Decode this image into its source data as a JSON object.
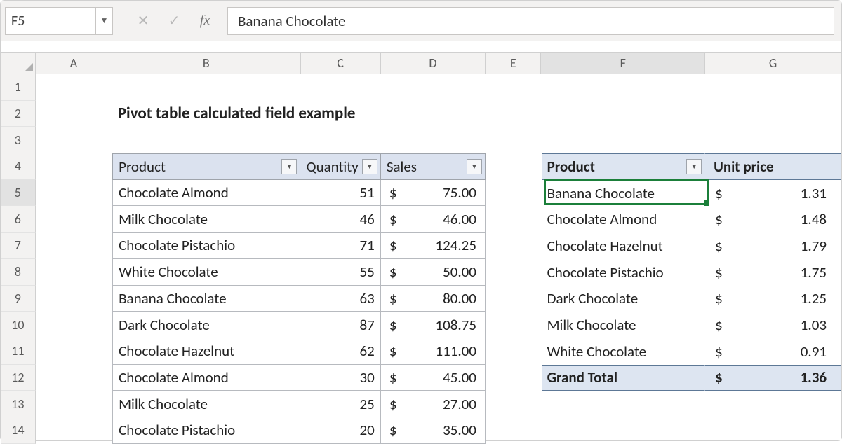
{
  "name_box": "F5",
  "formula_value": "Banana Chocolate",
  "columns": [
    "A",
    "B",
    "C",
    "D",
    "E",
    "F",
    "G"
  ],
  "row_numbers": [
    1,
    2,
    3,
    4,
    5,
    6,
    7,
    8,
    9,
    10,
    11,
    12,
    13,
    14
  ],
  "title": "Pivot table calculated field example",
  "source_table": {
    "headers": [
      "Product",
      "Quantity",
      "Sales"
    ],
    "rows": [
      {
        "product": "Chocolate Almond",
        "qty": "51",
        "sales": "75.00"
      },
      {
        "product": "Milk Chocolate",
        "qty": "46",
        "sales": "46.00"
      },
      {
        "product": "Chocolate Pistachio",
        "qty": "71",
        "sales": "124.25"
      },
      {
        "product": "White Chocolate",
        "qty": "55",
        "sales": "50.00"
      },
      {
        "product": "Banana Chocolate",
        "qty": "63",
        "sales": "80.00"
      },
      {
        "product": "Dark Chocolate",
        "qty": "87",
        "sales": "108.75"
      },
      {
        "product": "Chocolate Hazelnut",
        "qty": "62",
        "sales": "111.00"
      },
      {
        "product": "Chocolate Almond",
        "qty": "30",
        "sales": "45.00"
      },
      {
        "product": "Milk Chocolate",
        "qty": "25",
        "sales": "27.00"
      },
      {
        "product": "Chocolate Pistachio",
        "qty": "20",
        "sales": "35.00"
      }
    ]
  },
  "pivot_table": {
    "headers": [
      "Product",
      "Unit price"
    ],
    "rows": [
      {
        "product": "Banana Chocolate",
        "price": "1.31"
      },
      {
        "product": "Chocolate Almond",
        "price": "1.48"
      },
      {
        "product": "Chocolate Hazelnut",
        "price": "1.79"
      },
      {
        "product": "Chocolate Pistachio",
        "price": "1.75"
      },
      {
        "product": "Dark Chocolate",
        "price": "1.25"
      },
      {
        "product": "Milk Chocolate",
        "price": "1.03"
      },
      {
        "product": "White Chocolate",
        "price": "0.91"
      }
    ],
    "total_label": "Grand Total",
    "total_value": "1.36"
  },
  "currency": "$",
  "active_cell": {
    "col": "F",
    "row": 5
  }
}
